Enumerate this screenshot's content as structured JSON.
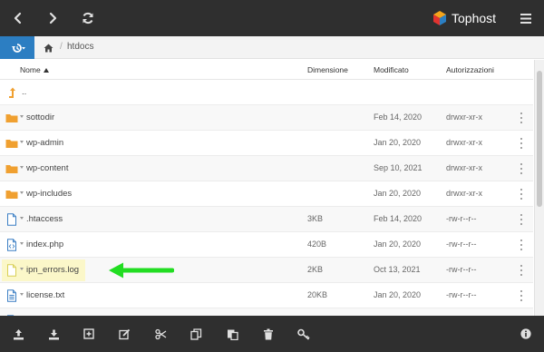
{
  "header": {
    "logo_text": "Tophost",
    "icons": [
      "chevron-left-icon",
      "chevron-right-icon",
      "refresh-icon",
      "hamburger-menu-icon"
    ]
  },
  "breadcrumb": {
    "items": [
      "htdocs"
    ]
  },
  "table": {
    "columns": {
      "name": "Nome",
      "size": "Dimensione",
      "modified": "Modificato",
      "permissions": "Autorizzazioni"
    },
    "parent_label": "..",
    "rows": [
      {
        "type": "folder",
        "name": "sottodir",
        "size": "",
        "date": "Feb 14, 2020",
        "perm": "drwxr-xr-x"
      },
      {
        "type": "folder",
        "name": "wp-admin",
        "size": "",
        "date": "Jan 20, 2020",
        "perm": "drwxr-xr-x"
      },
      {
        "type": "folder",
        "name": "wp-content",
        "size": "",
        "date": "Sep 10, 2021",
        "perm": "drwxr-xr-x"
      },
      {
        "type": "folder",
        "name": "wp-includes",
        "size": "",
        "date": "Jan 20, 2020",
        "perm": "drwxr-xr-x"
      },
      {
        "type": "file",
        "name": ".htaccess",
        "size": "3KB",
        "date": "Feb 14, 2020",
        "perm": "-rw-r--r--"
      },
      {
        "type": "code",
        "name": "index.php",
        "size": "420B",
        "date": "Jan 20, 2020",
        "perm": "-rw-r--r--"
      },
      {
        "type": "file",
        "name": "ipn_errors.log",
        "size": "2KB",
        "date": "Oct 13, 2021",
        "perm": "-rw-r--r--",
        "highlighted": true
      },
      {
        "type": "text",
        "name": "license.txt",
        "size": "20KB",
        "date": "Jan 20, 2020",
        "perm": "-rw-r--r--"
      },
      {
        "type": "file",
        "name": "",
        "size": "",
        "date": "",
        "perm": ""
      }
    ]
  },
  "colors": {
    "topbar": "#2f2f2f",
    "accent_blue": "#2c7ec2",
    "folder_orange": "#f0a030",
    "highlight_yellow": "#fbf7c9",
    "arrow_green": "#22dd22"
  },
  "toolbar": {
    "icons": [
      "upload-icon",
      "download-icon",
      "new-folder-icon",
      "edit-icon",
      "cut-icon",
      "copy-icon",
      "paste-icon",
      "delete-icon",
      "permissions-key-icon",
      "info-icon"
    ]
  }
}
